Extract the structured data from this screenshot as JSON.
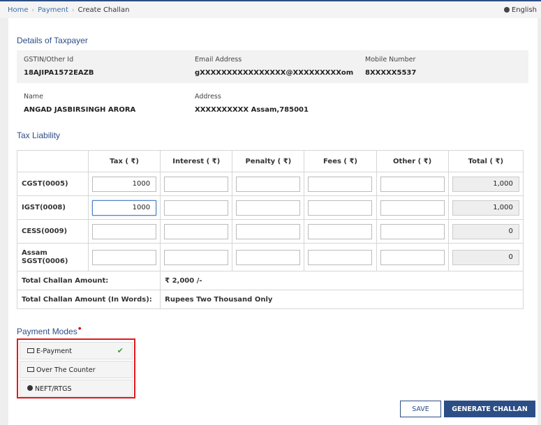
{
  "breadcrumb": {
    "home": "Home",
    "payment": "Payment",
    "current": "Create Challan"
  },
  "language": "English",
  "taxpayer": {
    "title": "Details of Taxpayer",
    "gstin_label": "GSTIN/Other Id",
    "gstin_value": "18AJIPA1572EAZB",
    "email_label": "Email Address",
    "email_value": "gXXXXXXXXXXXXXXXX@XXXXXXXXXom",
    "mobile_label": "Mobile Number",
    "mobile_value": "8XXXXX5537",
    "name_label": "Name",
    "name_value": "ANGAD JASBIRSINGH ARORA",
    "address_label": "Address",
    "address_value": "XXXXXXXXXX Assam,785001"
  },
  "tax_liability": {
    "title": "Tax Liability",
    "headers": [
      "Tax ( ₹)",
      "Interest ( ₹)",
      "Penalty ( ₹)",
      "Fees ( ₹)",
      "Other ( ₹)",
      "Total ( ₹)"
    ],
    "rows": [
      {
        "label": "CGST(0005)",
        "tax": "1000",
        "interest": "",
        "penalty": "",
        "fees": "",
        "other": "",
        "total": "1,000"
      },
      {
        "label": "IGST(0008)",
        "tax": "1000",
        "interest": "",
        "penalty": "",
        "fees": "",
        "other": "",
        "total": "1,000"
      },
      {
        "label": "CESS(0009)",
        "tax": "",
        "interest": "",
        "penalty": "",
        "fees": "",
        "other": "",
        "total": "0"
      },
      {
        "label": "Assam SGST(0006)",
        "tax": "",
        "interest": "",
        "penalty": "",
        "fees": "",
        "other": "",
        "total": "0"
      }
    ],
    "total_label": "Total Challan Amount:",
    "total_value": "₹ 2,000 /-",
    "words_label": "Total Challan Amount (In Words):",
    "words_value": "Rupees Two Thousand Only"
  },
  "payment_modes": {
    "title": "Payment Modes",
    "required_mark": "•",
    "options": [
      {
        "label": "E-Payment",
        "icon": "card-icon",
        "checked_mark": "✔"
      },
      {
        "label": "Over The Counter",
        "icon": "cash-icon"
      },
      {
        "label": "NEFT/RTGS",
        "icon": "bank-globe-icon"
      }
    ]
  },
  "buttons": {
    "save": "SAVE",
    "generate": "GENERATE CHALLAN"
  },
  "colors": {
    "accent": "#2c4e86",
    "highlight": "#e3181c",
    "check": "#3a9b3a"
  }
}
